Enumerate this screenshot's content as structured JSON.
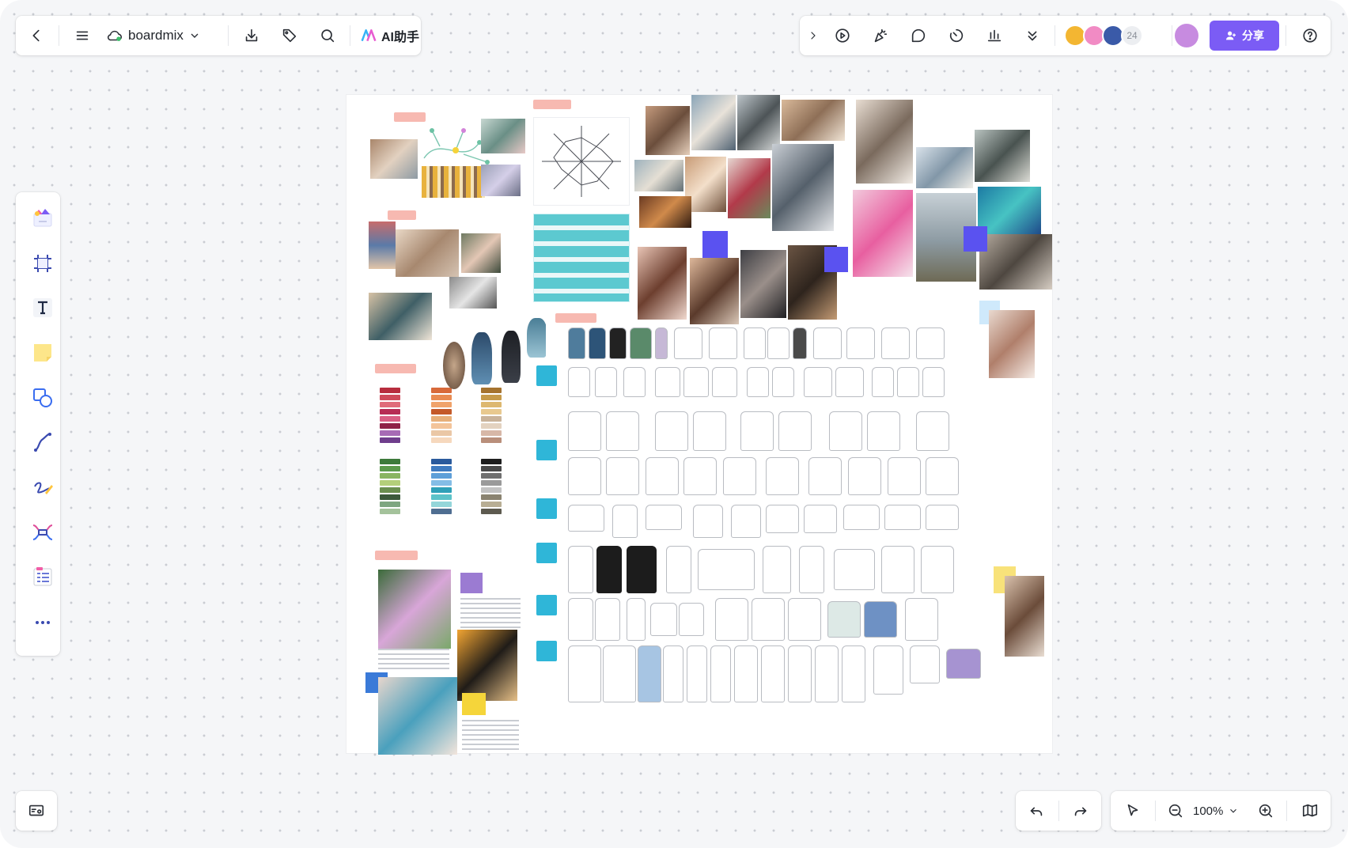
{
  "topbar": {
    "app_name": "boardmix",
    "ai_label": "AI助手",
    "collaborator_count": "24",
    "share_label": "分享"
  },
  "zoom": {
    "level": "100%"
  },
  "colors": {
    "accent": "#7b5cf5",
    "canvas_dot": "#c9ccd2",
    "palette_cyan": "#2fb6d8",
    "label_pink": "#f7b9b1"
  },
  "icons": {
    "back": "chevron-left-icon",
    "menu": "hamburger-icon",
    "cloud": "cloud-sync-icon",
    "export": "download-icon",
    "tag": "tag-icon",
    "search": "search-icon",
    "help": "help-icon"
  }
}
